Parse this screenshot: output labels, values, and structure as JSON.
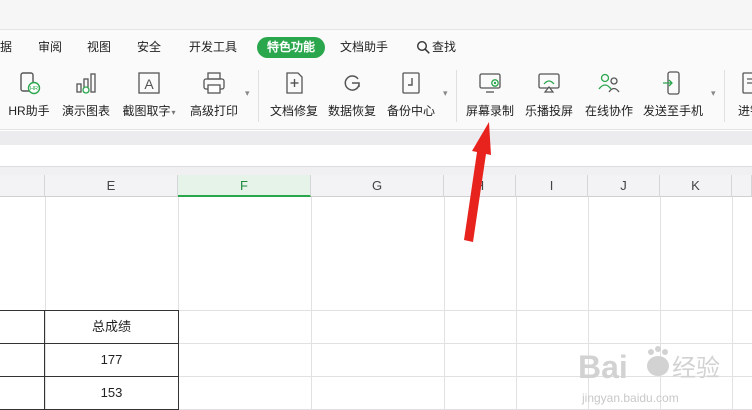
{
  "menu": {
    "items": [
      "据",
      "审阅",
      "视图",
      "安全",
      "开发工具",
      "特色功能",
      "文档助手"
    ],
    "active": "特色功能",
    "search_label": "查找"
  },
  "ribbon": {
    "tools": [
      {
        "label": "HR助手",
        "icon": "hr-assistant-icon"
      },
      {
        "label": "演示图表",
        "icon": "demo-chart-icon"
      },
      {
        "label": "截图取字",
        "icon": "screenshot-text-icon"
      },
      {
        "label": "高级打印",
        "icon": "printer-icon"
      },
      {
        "label": "文档修复",
        "icon": "doc-repair-icon"
      },
      {
        "label": "数据恢复",
        "icon": "data-recovery-icon"
      },
      {
        "label": "备份中心",
        "icon": "backup-center-icon"
      },
      {
        "label": "屏幕录制",
        "icon": "screen-record-icon"
      },
      {
        "label": "乐播投屏",
        "icon": "cast-screen-icon"
      },
      {
        "label": "在线协作",
        "icon": "collaboration-icon"
      },
      {
        "label": "发送至手机",
        "icon": "send-to-phone-icon"
      },
      {
        "label": "进销",
        "icon": "inventory-icon"
      }
    ],
    "dropdown_caret": "▾"
  },
  "sheet": {
    "columns": [
      "E",
      "F",
      "G",
      "H",
      "I",
      "J",
      "K"
    ],
    "selected_column": "F",
    "table": {
      "header": "总成绩",
      "values": [
        "177",
        "153"
      ]
    }
  },
  "watermark": {
    "brand": "Bai",
    "brand2": "经验",
    "url": "jingyan.baidu.com"
  },
  "colors": {
    "accent": "#2aa64c",
    "arrow": "#e8231d"
  }
}
